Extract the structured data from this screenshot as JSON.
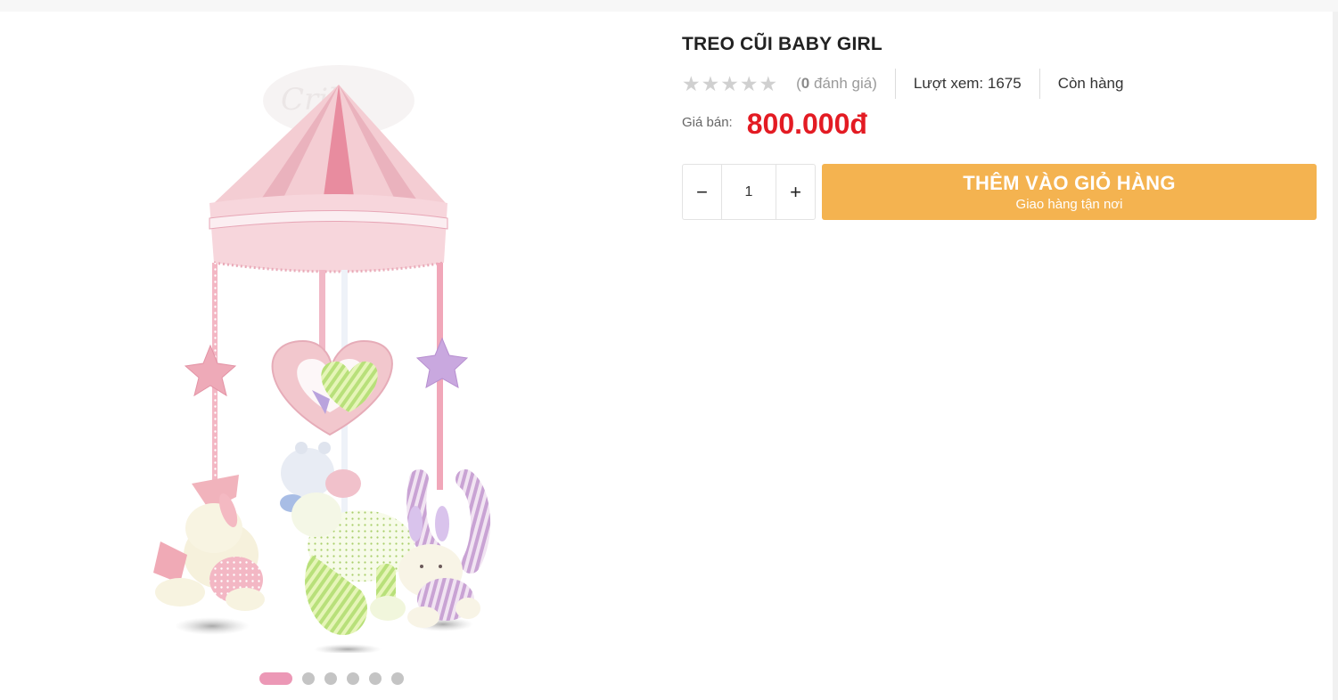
{
  "product": {
    "title": "TREO CŨI BABY GIRL",
    "rating": 0,
    "review_count": "0",
    "review_suffix": " đánh giá)",
    "review_prefix": "(",
    "views_label": "Lượt xem: 1675",
    "stock_status": "Còn hàng",
    "price_label": "Giá bán:",
    "price": "800.000đ",
    "quantity": "1"
  },
  "cart": {
    "button_label": "THÊM VÀO GIỎ HÀNG",
    "button_sublabel": "Giao hàng tận nơi",
    "minus_symbol": "−",
    "plus_symbol": "+"
  },
  "gallery": {
    "slide_count": 6,
    "active_index": 0
  },
  "colors": {
    "price": "#e31b23",
    "button": "#f4b350",
    "active_dot": "#ec98b6",
    "star_empty": "#d0d0d0"
  },
  "icons": {
    "star": "★"
  }
}
